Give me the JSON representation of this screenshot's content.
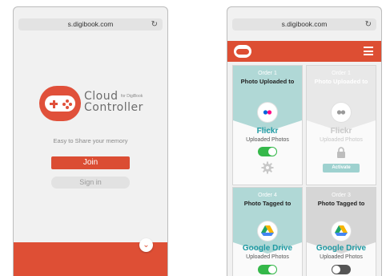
{
  "left_phone": {
    "url": "s.digibook.com",
    "reload_icon": "reload-icon",
    "brand": {
      "main": "Cloud Controller",
      "sub": "for DigiBook"
    },
    "tagline": "Easy to Share your memory",
    "join_label": "Join",
    "signin_label": "Sign in",
    "scroll_icon": "chevron-down-icon",
    "accent_color": "#de4f35"
  },
  "right_phone": {
    "url": "s.digibook.com",
    "reload_icon": "reload-icon",
    "menu_icon": "hamburger-menu-icon",
    "cards": [
      {
        "order": "Order 1",
        "event": "Photo Uploaded to",
        "service": "Flickr",
        "service_sub": "Uploaded Photos",
        "state": "enabled",
        "toggle": "on",
        "extra_icon": "gear-icon"
      },
      {
        "order": "Order 1",
        "event": "Photo Uploaded to",
        "service": "Flickr",
        "service_sub": "Uploaded Photos",
        "state": "locked",
        "extra_icon": "lock-icon",
        "activate_label": "Activate"
      },
      {
        "order": "Order 4",
        "event": "Photo Tagged to",
        "service": "Google Drive",
        "service_sub": "Uploaded Photos",
        "state": "enabled",
        "toggle": "on"
      },
      {
        "order": "Order 3",
        "event": "Photo Tagged to",
        "service": "Google Drive",
        "service_sub": "Uploaded Photos",
        "state": "disabled",
        "toggle": "off"
      }
    ],
    "colors": {
      "flickr_blue": "#0063dc",
      "flickr_pink": "#ff0084",
      "drive_teal": "#1f9aa3",
      "toggle_on": "#35b84a"
    }
  }
}
